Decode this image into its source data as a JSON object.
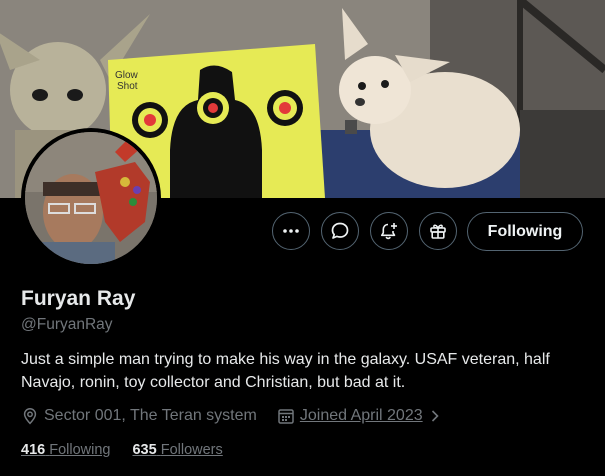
{
  "profile": {
    "name": "Furyan Ray",
    "handle": "@FuryanRay",
    "bio": "Just a simple man trying to make his way in the galaxy.  USAF veteran, half Navajo, ronin, toy collector  and Christian, but bad at it.",
    "location": "Sector 001, The Teran system",
    "joined": "Joined April 2023",
    "following_count": "416",
    "following_label": "Following",
    "followers_count": "635",
    "followers_label": "Followers"
  },
  "actions": {
    "follow_label": "Following",
    "more_icon": "more-horizontal-icon",
    "message_icon": "message-bubble-icon",
    "notify_icon": "bell-plus-icon",
    "gift_icon": "gift-icon"
  },
  "banner": {
    "target_text": "Glow Shot"
  },
  "colors": {
    "background": "#000000",
    "text": "#e7e9ea",
    "muted": "#71767b",
    "border": "#536471"
  }
}
